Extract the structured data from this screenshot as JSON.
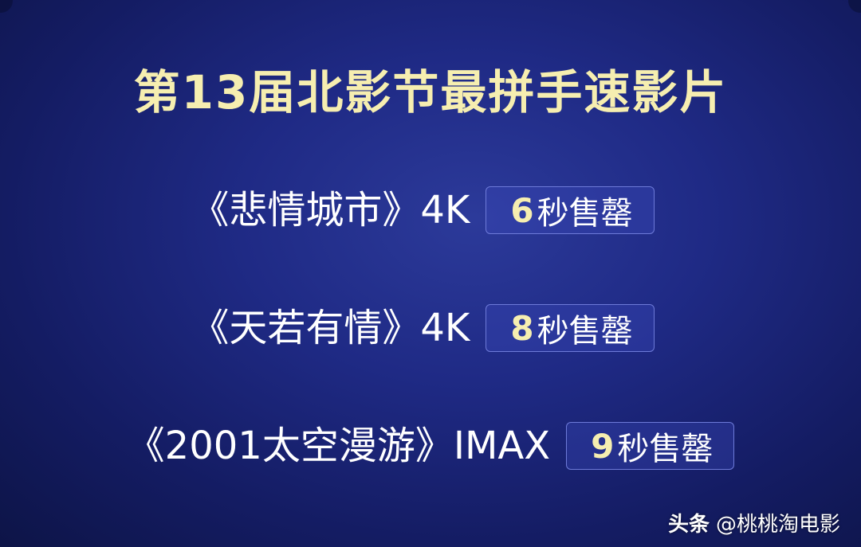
{
  "title": "第13届北影节最拼手速影片",
  "films": [
    {
      "name": "《悲情城市》4K",
      "sellout_seconds": "6",
      "sellout_text": "秒售罄"
    },
    {
      "name": "《天若有情》4K",
      "sellout_seconds": "8",
      "sellout_text": "秒售罄"
    },
    {
      "name": "《2001太空漫游》IMAX",
      "sellout_seconds": "9",
      "sellout_text": "秒售罄"
    }
  ],
  "watermark": {
    "brand": "头条",
    "handle": "@桃桃淘电影"
  },
  "colors": {
    "background": "#1f2a85",
    "title": "#f6eeb0",
    "badge_border": "#6d7ad8",
    "text": "#ffffff"
  }
}
